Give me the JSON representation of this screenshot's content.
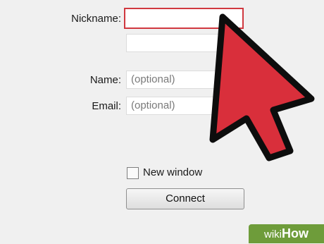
{
  "form": {
    "nickname_label": "Nickname:",
    "name_label": "Name:",
    "name_placeholder": "(optional)",
    "email_label": "Email:",
    "email_placeholder": "(optional)",
    "new_window_label": "New window",
    "new_window_checked": false,
    "connect_label": "Connect"
  },
  "overlay": {
    "arrow_icon": "pointer-arrow-icon",
    "arrow_color": "#d92f3b"
  },
  "watermark": {
    "prefix": "wiki",
    "suffix": "How"
  }
}
